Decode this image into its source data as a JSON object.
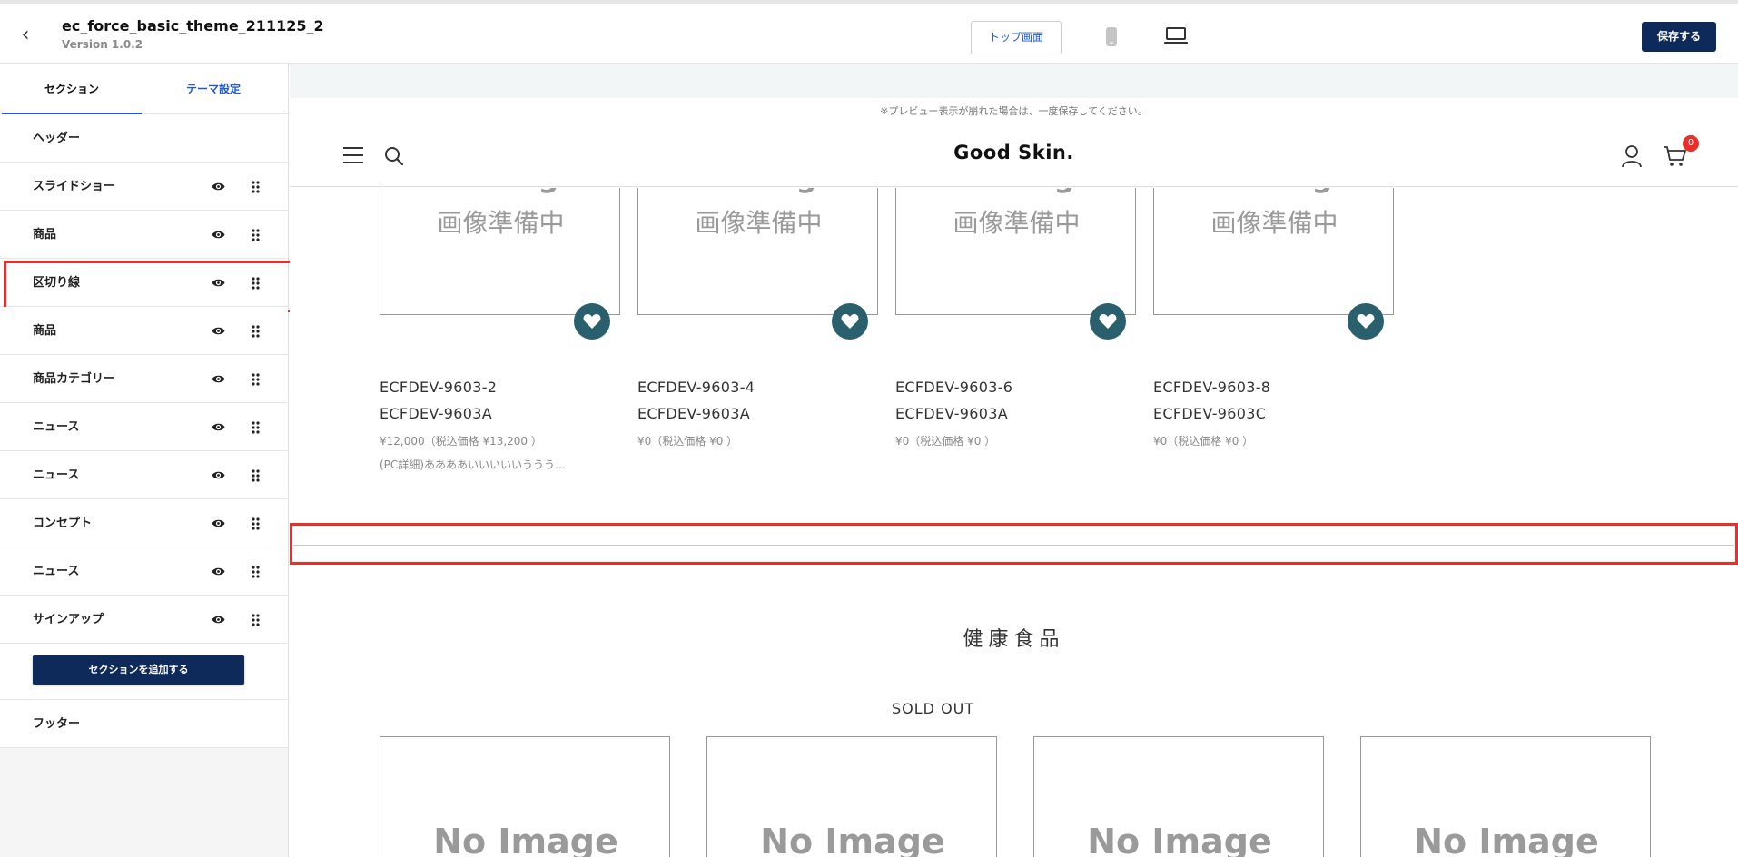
{
  "topbar": {
    "theme_name": "ec_force_basic_theme_211125_2",
    "version": "Version 1.0.2",
    "top_screen_label": "トップ画面",
    "save_label": "保存する",
    "back_icon": "chevron-left-icon"
  },
  "sidebar": {
    "tabs": [
      {
        "label": "セクション",
        "active": true
      },
      {
        "label": "テーマ設定",
        "active": false
      }
    ],
    "header_item": "ヘッダー",
    "sections": [
      {
        "label": "スライドショー",
        "selected": false
      },
      {
        "label": "商品",
        "selected": false
      },
      {
        "label": "区切り線",
        "selected": true
      },
      {
        "label": "商品",
        "selected": false
      },
      {
        "label": "商品カテゴリー",
        "selected": false
      },
      {
        "label": "ニュース",
        "selected": false
      },
      {
        "label": "ニュース",
        "selected": false
      },
      {
        "label": "コンセプト",
        "selected": false
      },
      {
        "label": "ニュース",
        "selected": false
      },
      {
        "label": "サインアップ",
        "selected": false
      }
    ],
    "add_section_label": "セクションを追加する",
    "footer_item": "フッター"
  },
  "preview": {
    "note": "※プレビュー表示が崩れた場合は、一度保存してください。",
    "logo": "Good Skin.",
    "cart_count": "0",
    "products": [
      {
        "image_text": "No Image",
        "image_jp": "画像準備中",
        "code1": "ECFDEV-9603-2",
        "code2": "ECFDEV-9603A",
        "price": "¥12,000（税込価格 ¥13,200 ）",
        "desc": "(PC詳細)ああああいいいいいううう…"
      },
      {
        "image_text": "No Image",
        "image_jp": "画像準備中",
        "code1": "ECFDEV-9603-4",
        "code2": "ECFDEV-9603A",
        "price": "¥0（税込価格 ¥0 ）",
        "desc": ""
      },
      {
        "image_text": "No Image",
        "image_jp": "画像準備中",
        "code1": "ECFDEV-9603-6",
        "code2": "ECFDEV-9603A",
        "price": "¥0（税込価格 ¥0 ）",
        "desc": ""
      },
      {
        "image_text": "No Image",
        "image_jp": "画像準備中",
        "code1": "ECFDEV-9603-8",
        "code2": "ECFDEV-9603C",
        "price": "¥0（税込価格 ¥0 ）",
        "desc": ""
      }
    ],
    "category_title": "健康食品",
    "sold_out": "SOLD OUT",
    "bottom_cards": [
      {
        "image_text": "No Image"
      },
      {
        "image_text": "No Image"
      },
      {
        "image_text": "No Image"
      },
      {
        "image_text": "No Image"
      }
    ]
  },
  "colors": {
    "primary_navy": "#0e2a5a",
    "link_blue": "#1e5bd2",
    "highlight_red": "#e8302a",
    "fav_teal": "#2a5f6e"
  }
}
